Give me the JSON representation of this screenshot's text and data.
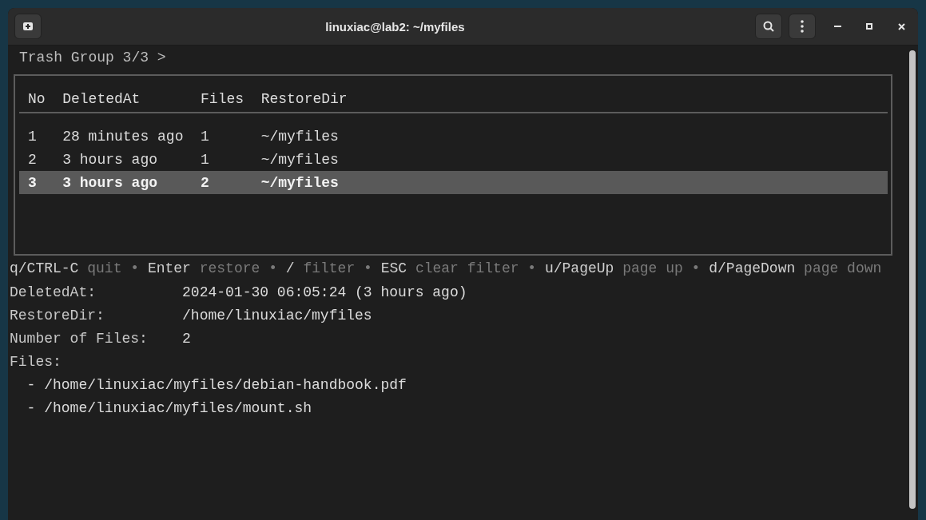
{
  "window": {
    "title": "linuxiac@lab2: ~/myfiles"
  },
  "breadcrumb": "Trash Group 3/3 >",
  "table": {
    "columns": [
      "No",
      "DeletedAt",
      "Files",
      "RestoreDir"
    ],
    "rows": [
      {
        "cells": [
          "1",
          "28 minutes ago",
          "1",
          "~/myfiles"
        ],
        "selected": false
      },
      {
        "cells": [
          "2",
          "3 hours ago",
          "1",
          "~/myfiles"
        ],
        "selected": false
      },
      {
        "cells": [
          "3",
          "3 hours ago",
          "2",
          "~/myfiles"
        ],
        "selected": true
      }
    ]
  },
  "help": {
    "separator": "•",
    "items": [
      {
        "key": "q/CTRL-C",
        "action": "quit"
      },
      {
        "key": "Enter",
        "action": "restore"
      },
      {
        "key": "/",
        "action": "filter"
      },
      {
        "key": "ESC",
        "action": "clear filter"
      },
      {
        "key": "u/PageUp",
        "action": "page up"
      },
      {
        "key": "d/PageDown",
        "action": "page down"
      }
    ]
  },
  "details": [
    {
      "label": "DeletedAt:",
      "value": "2024-01-30 06:05:24 (3 hours ago)"
    },
    {
      "label": "RestoreDir:",
      "value": "/home/linuxiac/myfiles"
    },
    {
      "label": "Number of Files:",
      "value": "2"
    }
  ],
  "files": {
    "label": "Files:",
    "items": [
      {
        "marker": "-",
        "path": "/home/linuxiac/myfiles/debian-handbook.pdf"
      },
      {
        "marker": "-",
        "path": "/home/linuxiac/myfiles/mount.sh"
      }
    ]
  }
}
